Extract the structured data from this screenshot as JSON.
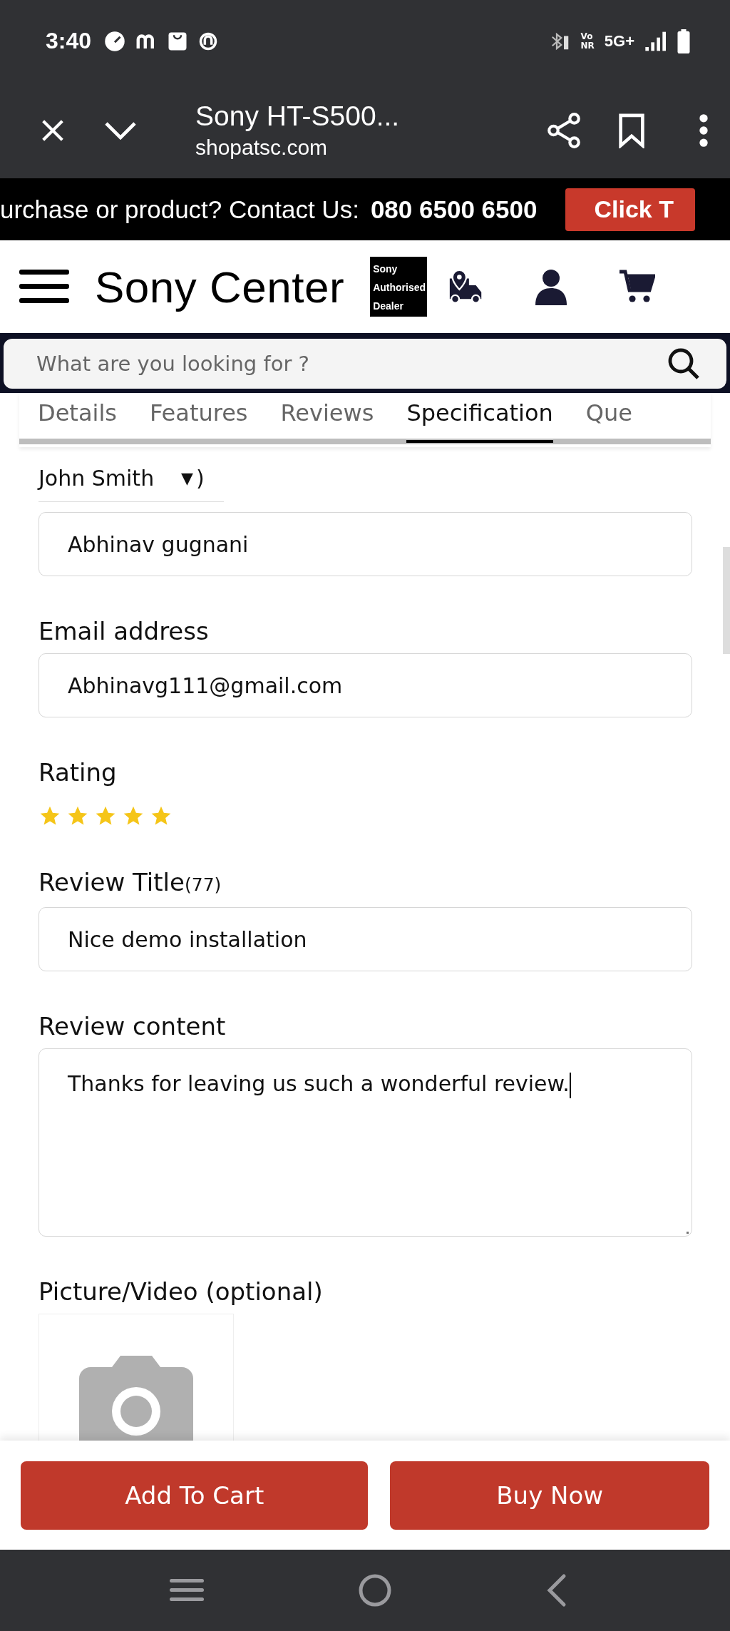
{
  "status_bar": {
    "time": "3:40",
    "voice_top": "Vo",
    "voice_bottom": "NR",
    "network": "5G+"
  },
  "browser_bar": {
    "title": "Sony HT-S500...",
    "url": "shopatsc.com"
  },
  "promo_bar": {
    "text": "urchase or product? Contact Us:",
    "phone": "080 6500 6500",
    "button": "Click T"
  },
  "header": {
    "logo": "Sony Center",
    "badge": [
      "Sony",
      "Authorised",
      "Dealer"
    ]
  },
  "search": {
    "placeholder": "What are you looking for ?"
  },
  "tabs": [
    {
      "label": "Details",
      "selected": false
    },
    {
      "label": "Features",
      "selected": false
    },
    {
      "label": "Reviews",
      "selected": false
    },
    {
      "label": "Specification",
      "selected": true
    },
    {
      "label": "Que",
      "selected": false
    }
  ],
  "form": {
    "name_select": {
      "value": "John Smith",
      "arrow": "▼",
      "suffix": ")"
    },
    "fields": [
      {
        "kind": "input",
        "value": "Abhinav gugnani"
      },
      {
        "kind": "input",
        "label": "Email address",
        "value": "Abhinavg111@gmail.com"
      },
      {
        "kind": "rating",
        "label": "Rating",
        "stars": 5
      },
      {
        "kind": "input",
        "label": "Review Title",
        "count": "(77)",
        "value": "Nice demo installation"
      },
      {
        "kind": "textarea",
        "label": "Review content",
        "value": "Thanks for leaving us such a wonderful review."
      },
      {
        "kind": "upload",
        "label": "Picture/Video (optional)"
      }
    ]
  },
  "actions": [
    "Add To Cart",
    "Buy Now"
  ]
}
